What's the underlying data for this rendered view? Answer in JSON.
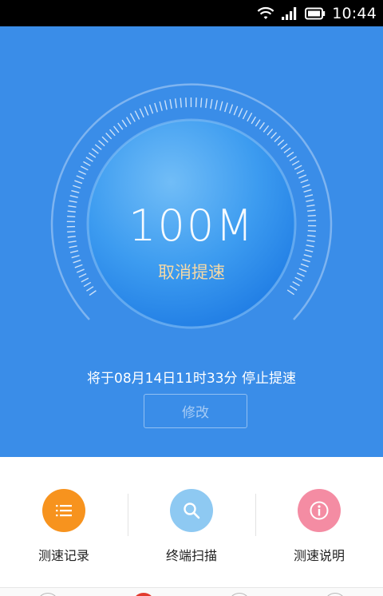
{
  "status_bar": {
    "time": "10:44",
    "icons": [
      "wifi-icon",
      "signal-icon",
      "battery-icon"
    ]
  },
  "speed_panel": {
    "speed_value": "100M",
    "cancel_label": "取消提速",
    "notice_text": "将于08月14日11时33分 停止提速",
    "modify_label": "修改"
  },
  "actions": [
    {
      "label": "测速记录",
      "icon": "list-icon",
      "color": "#f7931e"
    },
    {
      "label": "终端扫描",
      "icon": "search-icon",
      "color": "#8ec9f2"
    },
    {
      "label": "测速说明",
      "icon": "info-icon",
      "color": "#f48ca3"
    }
  ],
  "colors": {
    "hero_bg": "#3a8de8",
    "cancel_text": "#f5d9a6",
    "bottom_tab_active": "#e23b2e"
  }
}
